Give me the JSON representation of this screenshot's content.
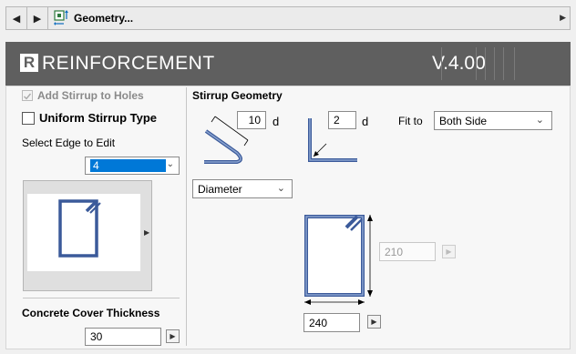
{
  "toolbar": {
    "title": "Geometry...",
    "back_icon": "left-arrow-icon",
    "forward_icon": "right-arrow-icon",
    "menu_icon": "right-arrow-icon"
  },
  "banner": {
    "logo_text": "R",
    "title": "REINFORCEMENT",
    "version": "V.4.00"
  },
  "left": {
    "add_stirrup_label": "Add Stirrup to Holes",
    "add_stirrup_checked": true,
    "uniform_label": "Uniform Stirrup Type",
    "uniform_checked": false,
    "select_edge_label": "Select Edge to Edit",
    "edge_value": "4",
    "cover_label": "Concrete Cover Thickness",
    "cover_value": "30"
  },
  "geometry": {
    "heading": "Stirrup Geometry",
    "hook1_value": "10",
    "hook1_unit": "d",
    "hook2_value": "2",
    "hook2_unit": "d",
    "fit_label": "Fit to",
    "fit_value": "Both Side",
    "diameter_value": "Diameter",
    "height_value": "210",
    "width_value": "240"
  },
  "colors": {
    "banner": "#5f5f5f",
    "accent": "#0078d7",
    "shape": "#3b5a9a"
  }
}
